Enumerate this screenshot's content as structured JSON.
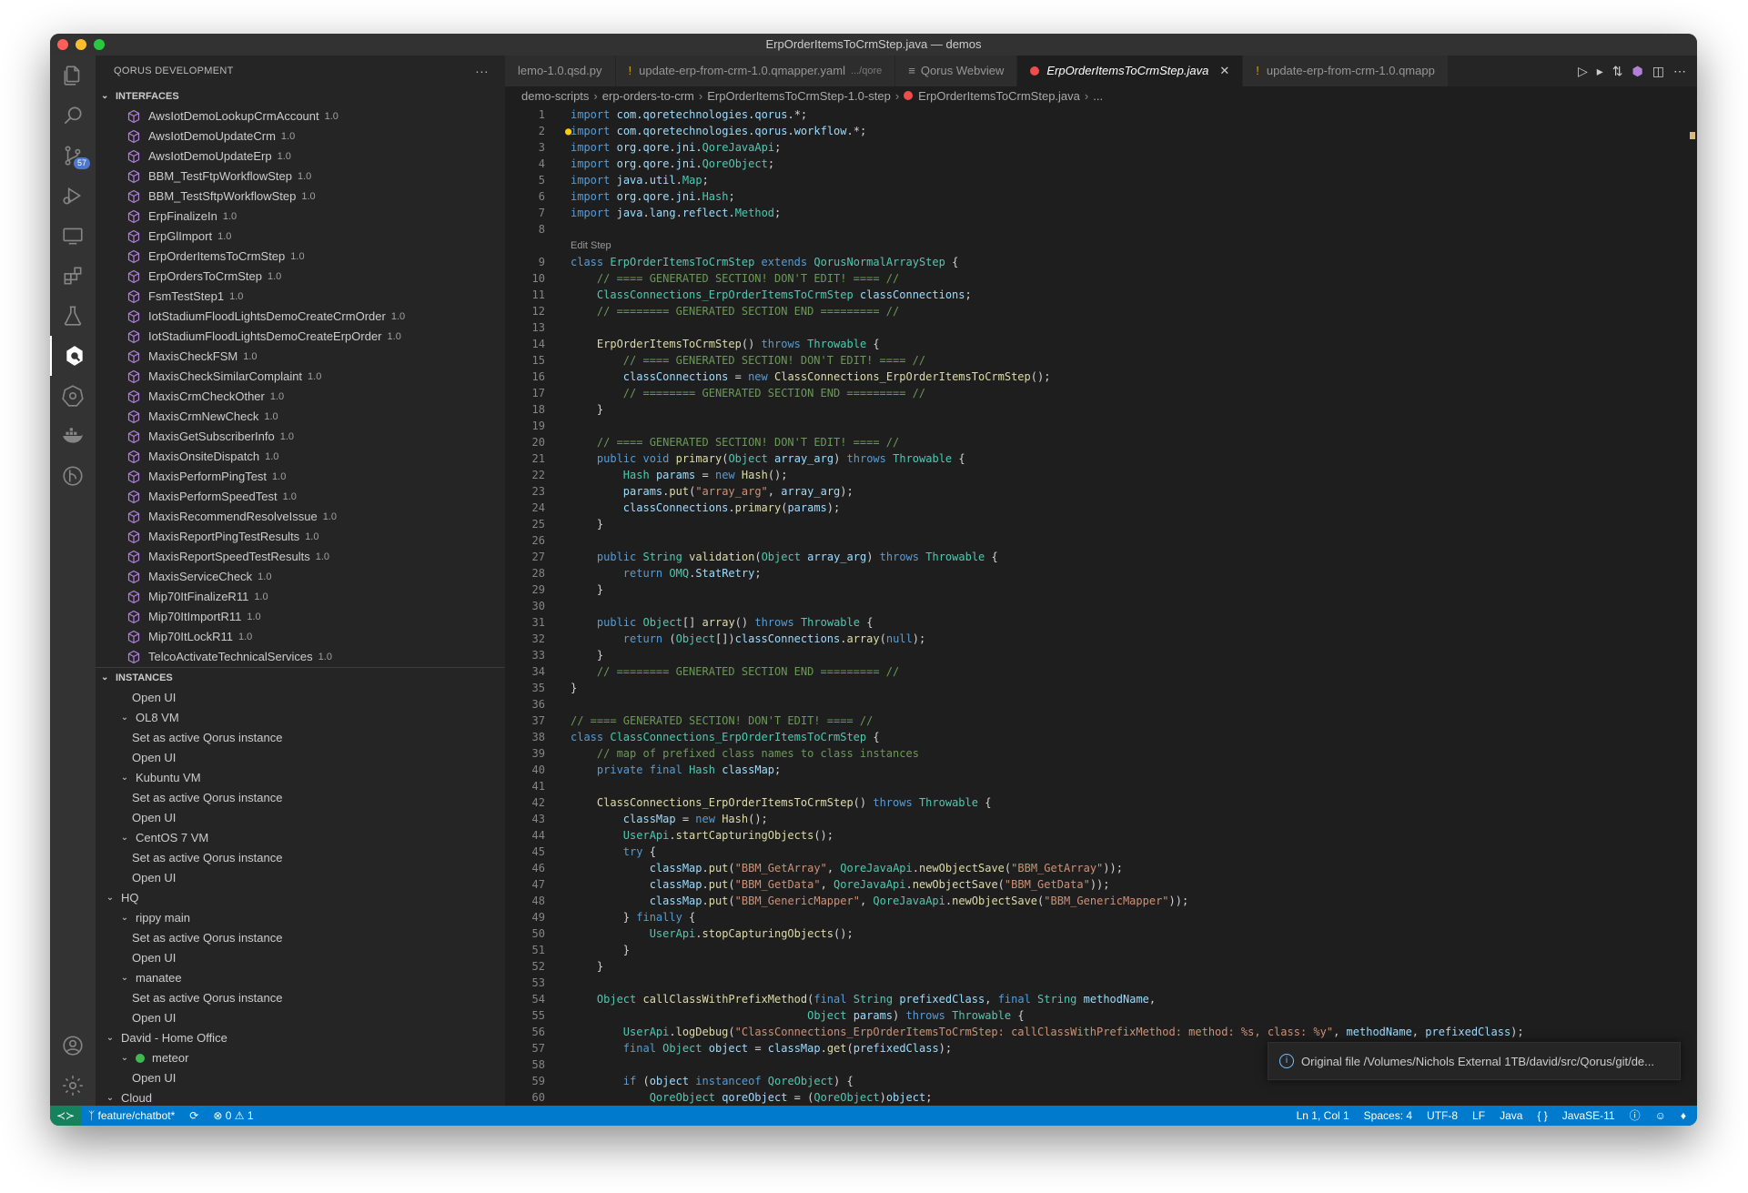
{
  "window": {
    "title": "ErpOrderItemsToCrmStep.java — demos"
  },
  "activity_bar": {
    "source_control_badge": "57"
  },
  "sidebar": {
    "title": "QORUS DEVELOPMENT",
    "more": "···",
    "interfaces_header": "INTERFACES",
    "interfaces": [
      {
        "name": "AwsIotDemoLookupCrmAccount",
        "version": "1.0"
      },
      {
        "name": "AwsIotDemoUpdateCrm",
        "version": "1.0"
      },
      {
        "name": "AwsIotDemoUpdateErp",
        "version": "1.0"
      },
      {
        "name": "BBM_TestFtpWorkflowStep",
        "version": "1.0"
      },
      {
        "name": "BBM_TestSftpWorkflowStep",
        "version": "1.0"
      },
      {
        "name": "ErpFinalizeIn",
        "version": "1.0"
      },
      {
        "name": "ErpGlImport",
        "version": "1.0"
      },
      {
        "name": "ErpOrderItemsToCrmStep",
        "version": "1.0"
      },
      {
        "name": "ErpOrdersToCrmStep",
        "version": "1.0"
      },
      {
        "name": "FsmTestStep1",
        "version": "1.0"
      },
      {
        "name": "IotStadiumFloodLightsDemoCreateCrmOrder",
        "version": "1.0"
      },
      {
        "name": "IotStadiumFloodLightsDemoCreateErpOrder",
        "version": "1.0"
      },
      {
        "name": "MaxisCheckFSM",
        "version": "1.0"
      },
      {
        "name": "MaxisCheckSimilarComplaint",
        "version": "1.0"
      },
      {
        "name": "MaxisCrmCheckOther",
        "version": "1.0"
      },
      {
        "name": "MaxisCrmNewCheck",
        "version": "1.0"
      },
      {
        "name": "MaxisGetSubscriberInfo",
        "version": "1.0"
      },
      {
        "name": "MaxisOnsiteDispatch",
        "version": "1.0"
      },
      {
        "name": "MaxisPerformPingTest",
        "version": "1.0"
      },
      {
        "name": "MaxisPerformSpeedTest",
        "version": "1.0"
      },
      {
        "name": "MaxisRecommendResolveIssue",
        "version": "1.0"
      },
      {
        "name": "MaxisReportPingTestResults",
        "version": "1.0"
      },
      {
        "name": "MaxisReportSpeedTestResults",
        "version": "1.0"
      },
      {
        "name": "MaxisServiceCheck",
        "version": "1.0"
      },
      {
        "name": "Mip70ItFinalizeR11",
        "version": "1.0"
      },
      {
        "name": "Mip70ItImportR11",
        "version": "1.0"
      },
      {
        "name": "Mip70ItLockR11",
        "version": "1.0"
      },
      {
        "name": "TelcoActivateTechnicalServices",
        "version": "1.0"
      }
    ],
    "instances_header": "INSTANCES",
    "instances": [
      {
        "label": "Open UI",
        "level": 2,
        "chevron": false,
        "dot": false
      },
      {
        "label": "OL8 VM",
        "level": 1,
        "chevron": true,
        "dot": false
      },
      {
        "label": "Set as active Qorus instance",
        "level": 2,
        "chevron": false,
        "dot": false
      },
      {
        "label": "Open UI",
        "level": 2,
        "chevron": false,
        "dot": false
      },
      {
        "label": "Kubuntu VM",
        "level": 1,
        "chevron": true,
        "dot": false
      },
      {
        "label": "Set as active Qorus instance",
        "level": 2,
        "chevron": false,
        "dot": false
      },
      {
        "label": "Open UI",
        "level": 2,
        "chevron": false,
        "dot": false
      },
      {
        "label": "CentOS 7 VM",
        "level": 1,
        "chevron": true,
        "dot": false
      },
      {
        "label": "Set as active Qorus instance",
        "level": 2,
        "chevron": false,
        "dot": false
      },
      {
        "label": "Open UI",
        "level": 2,
        "chevron": false,
        "dot": false
      },
      {
        "label": "HQ",
        "level": 0,
        "chevron": true,
        "dot": false
      },
      {
        "label": "rippy main",
        "level": 1,
        "chevron": true,
        "dot": false
      },
      {
        "label": "Set as active Qorus instance",
        "level": 2,
        "chevron": false,
        "dot": false
      },
      {
        "label": "Open UI",
        "level": 2,
        "chevron": false,
        "dot": false
      },
      {
        "label": "manatee",
        "level": 1,
        "chevron": true,
        "dot": false
      },
      {
        "label": "Set as active Qorus instance",
        "level": 2,
        "chevron": false,
        "dot": false
      },
      {
        "label": "Open UI",
        "level": 2,
        "chevron": false,
        "dot": false
      },
      {
        "label": "David - Home Office",
        "level": 0,
        "chevron": true,
        "dot": false
      },
      {
        "label": "meteor",
        "level": 1,
        "chevron": true,
        "dot": true
      },
      {
        "label": "Open UI",
        "level": 2,
        "chevron": false,
        "dot": false
      },
      {
        "label": "Cloud",
        "level": 0,
        "chevron": true,
        "dot": false
      }
    ]
  },
  "tabs": [
    {
      "label": "lemo-1.0.qsd.py",
      "description": "",
      "marker": "none",
      "active": false
    },
    {
      "label": "update-erp-from-crm-1.0.qmapper.yaml",
      "description": ".../qore",
      "marker": "yaml",
      "active": false
    },
    {
      "label": "Qorus Webview",
      "description": "",
      "marker": "webview",
      "active": false
    },
    {
      "label": "ErpOrderItemsToCrmStep.java",
      "description": "",
      "marker": "error",
      "active": true
    },
    {
      "label": "update-erp-from-crm-1.0.qmapp",
      "description": "",
      "marker": "yaml",
      "active": false
    }
  ],
  "breadcrumb": [
    "demo-scripts",
    "erp-orders-to-crm",
    "ErpOrderItemsToCrmStep-1.0-step",
    "ErpOrderItemsToCrmStep.java",
    "..."
  ],
  "codelens": "Edit Step",
  "code": [
    {
      "n": "1",
      "html": "<span class='kw'>import</span> <span class='vr'>com</span>.<span class='vr'>qoretechnologies</span>.<span class='vr'>qorus</span>.*;"
    },
    {
      "n": "2",
      "html": "<span class='kw'>import</span> <span class='vr'>com</span>.<span class='vr'>qoretechnologies</span>.<span class='vr'>qorus</span>.<span class='vr'>workflow</span>.*;"
    },
    {
      "n": "3",
      "html": "<span class='kw'>import</span> <span class='vr'>org</span>.<span class='vr'>qore</span>.<span class='vr'>jni</span>.<span class='ty'>QoreJavaApi</span>;"
    },
    {
      "n": "4",
      "html": "<span class='kw'>import</span> <span class='vr'>org</span>.<span class='vr'>qore</span>.<span class='vr'>jni</span>.<span class='ty'>QoreObject</span>;"
    },
    {
      "n": "5",
      "html": "<span class='kw'>import</span> <span class='vr'>java</span>.<span class='vr'>util</span>.<span class='ty'>Map</span>;"
    },
    {
      "n": "6",
      "html": "<span class='kw'>import</span> <span class='vr'>org</span>.<span class='vr'>qore</span>.<span class='vr'>jni</span>.<span class='ty'>Hash</span>;"
    },
    {
      "n": "7",
      "html": "<span class='kw'>import</span> <span class='vr'>java</span>.<span class='vr'>lang</span>.<span class='vr'>reflect</span>.<span class='ty'>Method</span>;"
    },
    {
      "n": "8",
      "html": ""
    },
    {
      "n": "9",
      "lens": true,
      "html": "<span class='kw'>class</span> <span class='ty'>ErpOrderItemsToCrmStep</span> <span class='kw'>extends</span> <span class='ty'>QorusNormalArrayStep</span> {"
    },
    {
      "n": "10",
      "html": "    <span class='cm'>// ==== GENERATED SECTION! DON'T EDIT! ==== //</span>"
    },
    {
      "n": "11",
      "html": "    <span class='ty'>ClassConnections_ErpOrderItemsToCrmStep</span> <span class='vr'>classConnections</span>;"
    },
    {
      "n": "12",
      "html": "    <span class='cm'>// ======== GENERATED SECTION END ========= //</span>"
    },
    {
      "n": "13",
      "html": ""
    },
    {
      "n": "14",
      "html": "    <span class='fn'>ErpOrderItemsToCrmStep</span>() <span class='kw'>throws</span> <span class='ty'>Throwable</span> {"
    },
    {
      "n": "15",
      "html": "        <span class='cm'>// ==== GENERATED SECTION! DON'T EDIT! ==== //</span>"
    },
    {
      "n": "16",
      "html": "        <span class='vr'>classConnections</span> = <span class='kw'>new</span> <span class='fn'>ClassConnections_ErpOrderItemsToCrmStep</span>();"
    },
    {
      "n": "17",
      "html": "        <span class='cm'>// ======== GENERATED SECTION END ========= //</span>"
    },
    {
      "n": "18",
      "html": "    }"
    },
    {
      "n": "19",
      "html": ""
    },
    {
      "n": "20",
      "html": "    <span class='cm'>// ==== GENERATED SECTION! DON'T EDIT! ==== //</span>"
    },
    {
      "n": "21",
      "html": "    <span class='kw'>public</span> <span class='kw'>void</span> <span class='fn'>primary</span>(<span class='ty'>Object</span> <span class='vr'>array_arg</span>) <span class='kw'>throws</span> <span class='ty'>Throwable</span> {"
    },
    {
      "n": "22",
      "html": "        <span class='ty'>Hash</span> <span class='vr'>params</span> = <span class='kw'>new</span> <span class='fn'>Hash</span>();"
    },
    {
      "n": "23",
      "html": "        <span class='vr'>params</span>.<span class='fn'>put</span>(<span class='st'>\"array_arg\"</span>, <span class='vr'>array_arg</span>);"
    },
    {
      "n": "24",
      "html": "        <span class='vr'>classConnections</span>.<span class='fn'>primary</span>(<span class='vr'>params</span>);"
    },
    {
      "n": "25",
      "html": "    }"
    },
    {
      "n": "26",
      "html": ""
    },
    {
      "n": "27",
      "html": "    <span class='kw'>public</span> <span class='ty'>String</span> <span class='fn'>validation</span>(<span class='ty'>Object</span> <span class='vr'>array_arg</span>) <span class='kw'>throws</span> <span class='ty'>Throwable</span> {"
    },
    {
      "n": "28",
      "html": "        <span class='kw'>return</span> <span class='ty'>OMQ</span>.<span class='vr'>StatRetry</span>;"
    },
    {
      "n": "29",
      "html": "    }"
    },
    {
      "n": "30",
      "html": ""
    },
    {
      "n": "31",
      "html": "    <span class='kw'>public</span> <span class='ty'>Object</span>[] <span class='fn'>array</span>() <span class='kw'>throws</span> <span class='ty'>Throwable</span> {"
    },
    {
      "n": "32",
      "html": "        <span class='kw'>return</span> (<span class='ty'>Object</span>[])<span class='vr'>classConnections</span>.<span class='fn'>array</span>(<span class='kw'>null</span>);"
    },
    {
      "n": "33",
      "html": "    }"
    },
    {
      "n": "34",
      "html": "    <span class='cm'>// ======== GENERATED SECTION END ========= //</span>"
    },
    {
      "n": "35",
      "html": "}"
    },
    {
      "n": "36",
      "html": ""
    },
    {
      "n": "37",
      "html": "<span class='cm'>// ==== GENERATED SECTION! DON'T EDIT! ==== //</span>"
    },
    {
      "n": "38",
      "html": "<span class='kw'>class</span> <span class='ty'>ClassConnections_ErpOrderItemsToCrmStep</span> {"
    },
    {
      "n": "39",
      "html": "    <span class='cm'>// map of prefixed class names to class instances</span>"
    },
    {
      "n": "40",
      "html": "    <span class='kw'>private</span> <span class='kw'>final</span> <span class='ty'>Hash</span> <span class='vr'>classMap</span>;"
    },
    {
      "n": "41",
      "html": ""
    },
    {
      "n": "42",
      "html": "    <span class='fn'>ClassConnections_ErpOrderItemsToCrmStep</span>() <span class='kw'>throws</span> <span class='ty'>Throwable</span> {"
    },
    {
      "n": "43",
      "html": "        <span class='vr'>classMap</span> = <span class='kw'>new</span> <span class='fn'>Hash</span>();"
    },
    {
      "n": "44",
      "html": "        <span class='ty'>UserApi</span>.<span class='fn'>startCapturingObjects</span>();"
    },
    {
      "n": "45",
      "html": "        <span class='kw'>try</span> {"
    },
    {
      "n": "46",
      "html": "            <span class='vr'>classMap</span>.<span class='fn'>put</span>(<span class='st'>\"BBM_GetArray\"</span>, <span class='ty'>QoreJavaApi</span>.<span class='fn'>newObjectSave</span>(<span class='st'>\"BBM_GetArray\"</span>));"
    },
    {
      "n": "47",
      "html": "            <span class='vr'>classMap</span>.<span class='fn'>put</span>(<span class='st'>\"BBM_GetData\"</span>, <span class='ty'>QoreJavaApi</span>.<span class='fn'>newObjectSave</span>(<span class='st'>\"BBM_GetData\"</span>));"
    },
    {
      "n": "48",
      "html": "            <span class='vr'>classMap</span>.<span class='fn'>put</span>(<span class='st'>\"BBM_GenericMapper\"</span>, <span class='ty'>QoreJavaApi</span>.<span class='fn'>newObjectSave</span>(<span class='st'>\"BBM_GenericMapper\"</span>));"
    },
    {
      "n": "49",
      "html": "        } <span class='kw'>finally</span> {"
    },
    {
      "n": "50",
      "html": "            <span class='ty'>UserApi</span>.<span class='fn'>stopCapturingObjects</span>();"
    },
    {
      "n": "51",
      "html": "        }"
    },
    {
      "n": "52",
      "html": "    }"
    },
    {
      "n": "53",
      "html": ""
    },
    {
      "n": "54",
      "html": "    <span class='ty'>Object</span> <span class='fn'>callClassWithPrefixMethod</span>(<span class='kw'>final</span> <span class='ty'>String</span> <span class='vr'>prefixedClass</span>, <span class='kw'>final</span> <span class='ty'>String</span> <span class='vr'>methodName</span>,"
    },
    {
      "n": "55",
      "html": "                                    <span class='ty'>Object</span> <span class='vr'>params</span>) <span class='kw'>throws</span> <span class='ty'>Throwable</span> {"
    },
    {
      "n": "56",
      "html": "        <span class='ty'>UserApi</span>.<span class='fn'>logDebug</span>(<span class='st'>\"ClassConnections_ErpOrderItemsToCrmStep: callClassWithPrefixMethod: method: %s, class: %y\"</span>, <span class='vr'>methodName</span>, <span class='vr'>prefixedClass</span>);"
    },
    {
      "n": "57",
      "html": "        <span class='kw'>final</span> <span class='ty'>Object</span> <span class='vr'>object</span> = <span class='vr'>classMap</span>.<span class='fn'>get</span>(<span class='vr'>prefixedClass</span>);"
    },
    {
      "n": "58",
      "html": ""
    },
    {
      "n": "59",
      "html": "        <span class='kw'>if</span> (<span class='vr'>object</span> <span class='kw'>instanceof</span> <span class='ty'>QoreObject</span>) {"
    },
    {
      "n": "60",
      "html": "            <span class='ty'>QoreObject</span> <span class='vr'>qoreObject</span> = (<span class='ty'>QoreObject</span>)<span class='vr'>object</span>;"
    }
  ],
  "notification": {
    "text": "Original file /Volumes/Nichols External 1TB/david/src/Qorus/git/de..."
  },
  "statusbar": {
    "branch": "feature/chatbot*",
    "problems": "⊗ 0 ⚠ 1",
    "position": "Ln 1, Col 1",
    "spaces": "Spaces: 4",
    "encoding": "UTF-8",
    "eol": "LF",
    "language": "Java",
    "java_version": "JavaSE-11"
  }
}
